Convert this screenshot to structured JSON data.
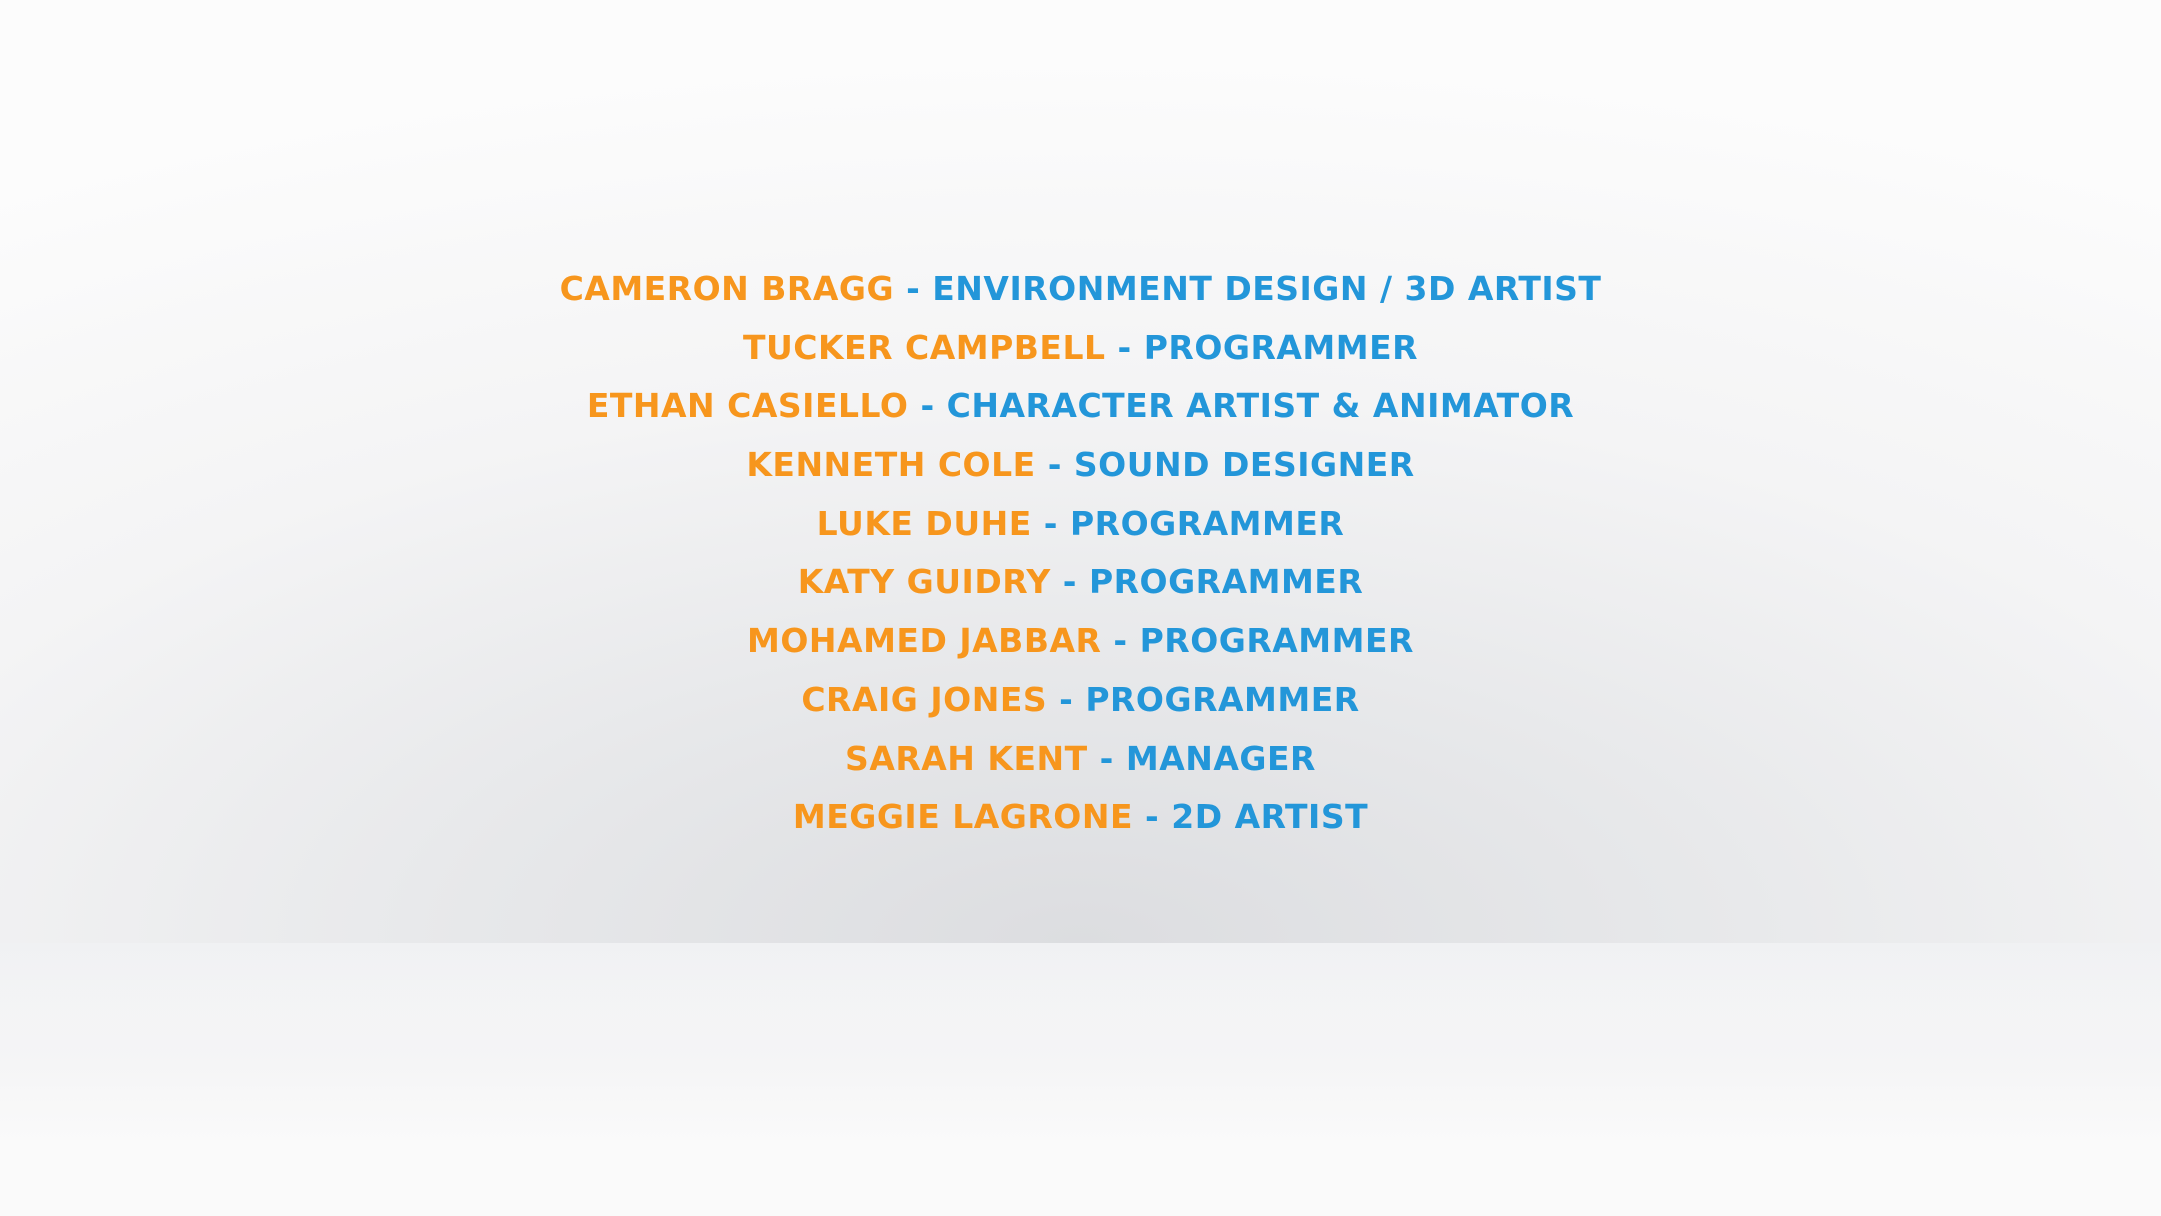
{
  "colors": {
    "name": "#f7961d",
    "role": "#2396d9"
  },
  "credits": [
    {
      "name": "Cameron Bragg",
      "separator": "-",
      "role": "Environment Design / 3D Artist"
    },
    {
      "name": "Tucker Campbell",
      "separator": "-",
      "role": "Programmer"
    },
    {
      "name": "Ethan Casiello",
      "separator": "-",
      "role": "Character Artist & Animator"
    },
    {
      "name": "Kenneth Cole",
      "separator": "-",
      "role": "Sound Designer"
    },
    {
      "name": "Luke Duhe",
      "separator": "-",
      "role": "Programmer"
    },
    {
      "name": "Katy Guidry",
      "separator": "-",
      "role": "Programmer"
    },
    {
      "name": "Mohamed Jabbar",
      "separator": "-",
      "role": "Programmer"
    },
    {
      "name": "Craig Jones",
      "separator": "-",
      "role": "Programmer"
    },
    {
      "name": "Sarah Kent",
      "separator": "-",
      "role": "Manager"
    },
    {
      "name": "Meggie LaGrone",
      "separator": "-",
      "role": "2D Artist"
    }
  ]
}
